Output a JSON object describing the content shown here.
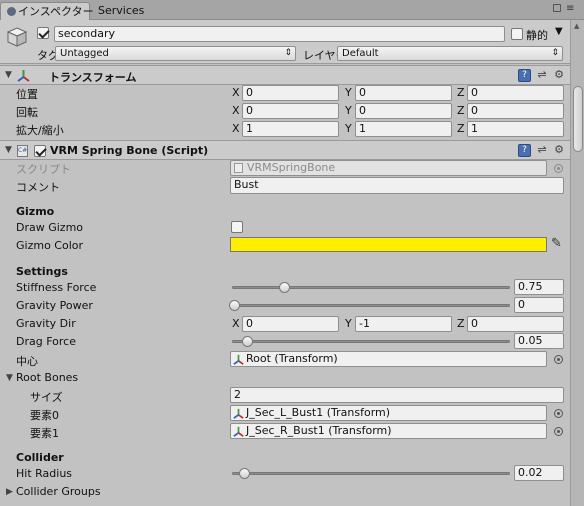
{
  "tabs": {
    "inspector": "インスペクター",
    "services": "Services"
  },
  "gameobject": {
    "name": "secondary",
    "active": true,
    "static_label": "静的",
    "tag_label": "タグ",
    "tag_value": "Untagged",
    "layer_label": "レイヤー",
    "layer_value": "Default"
  },
  "transform": {
    "title": "トランスフォーム",
    "rows": [
      {
        "label": "位置",
        "x": "0",
        "y": "0",
        "z": "0"
      },
      {
        "label": "回転",
        "x": "0",
        "y": "0",
        "z": "0"
      },
      {
        "label": "拡大/縮小",
        "x": "1",
        "y": "1",
        "z": "1"
      }
    ]
  },
  "spring_bone": {
    "title": "VRM Spring Bone (Script)",
    "script_label": "スクリプト",
    "script_value": "VRMSpringBone",
    "comment_label": "コメント",
    "comment_value": "Bust",
    "gizmo_header": "Gizmo",
    "draw_gizmo_label": "Draw Gizmo",
    "draw_gizmo": false,
    "gizmo_color_label": "Gizmo Color",
    "gizmo_color": "#ffee00",
    "settings_header": "Settings",
    "stiffness_label": "Stiffness Force",
    "stiffness_value": "0.75",
    "stiffness_level": 0.19,
    "gravity_power_label": "Gravity Power",
    "gravity_power_value": "0",
    "gravity_power_level": 0,
    "gravity_dir_label": "Gravity Dir",
    "gravity_dir": {
      "x": "0",
      "y": "-1",
      "z": "0"
    },
    "drag_label": "Drag Force",
    "drag_value": "0.05",
    "drag_level": 0.05,
    "center_label": "中心",
    "center_value": "Root (Transform)",
    "root_bones_label": "Root Bones",
    "size_label": "サイズ",
    "size_value": "2",
    "elements": [
      {
        "label": "要素0",
        "value": "J_Sec_L_Bust1 (Transform)"
      },
      {
        "label": "要素1",
        "value": "J_Sec_R_Bust1 (Transform)"
      }
    ],
    "collider_header": "Collider",
    "hit_radius_label": "Hit Radius",
    "hit_radius_value": "0.02",
    "hit_radius_level": 0.04,
    "collider_groups_label": "Collider Groups"
  },
  "axis_labels": {
    "x": "X",
    "y": "Y",
    "z": "Z"
  }
}
